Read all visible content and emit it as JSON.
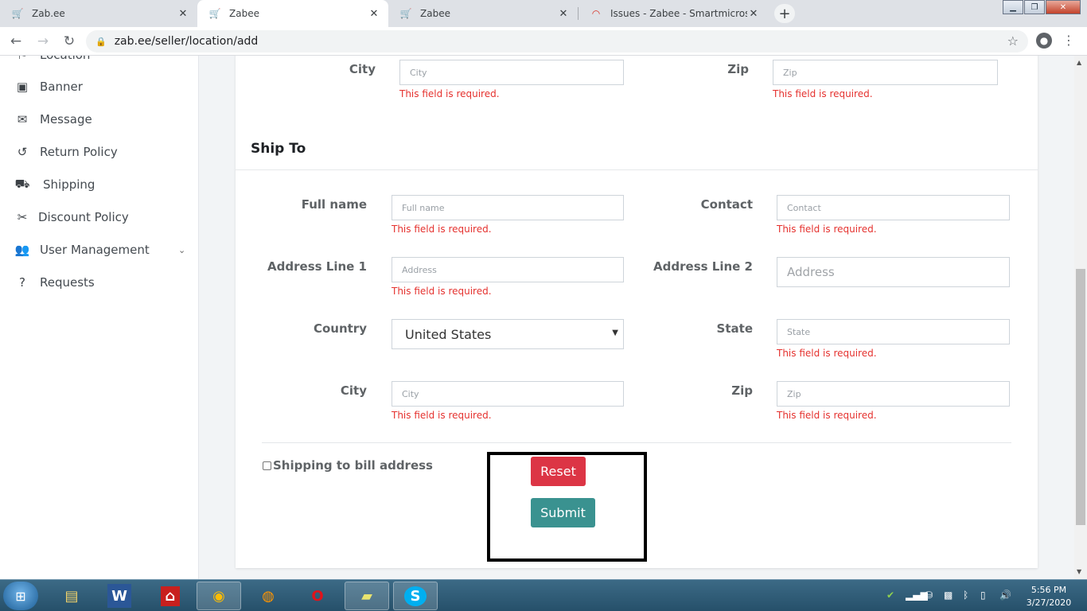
{
  "browser": {
    "tabs": [
      {
        "title": "Zab.ee",
        "active": false
      },
      {
        "title": "Zabee",
        "active": true
      },
      {
        "title": "Zabee",
        "active": false
      },
      {
        "title": "Issues - Zabee - Smartmicros Pro",
        "active": false
      }
    ],
    "url": "zab.ee/seller/location/add"
  },
  "sidebar": {
    "partial_item": "Location",
    "items": [
      {
        "label": "Banner",
        "icon": "image-icon"
      },
      {
        "label": "Message",
        "icon": "envelope-icon"
      },
      {
        "label": "Return Policy",
        "icon": "undo-icon"
      },
      {
        "label": "Shipping",
        "icon": "truck-icon"
      },
      {
        "label": "Discount Policy",
        "icon": "scissors-icon"
      },
      {
        "label": "User Management",
        "icon": "users-icon"
      },
      {
        "label": "Requests",
        "icon": "question-circle-icon"
      }
    ]
  },
  "bill_to_partial": {
    "city_label": "City",
    "city_placeholder": "City",
    "zip_label": "Zip",
    "zip_placeholder": "Zip",
    "error": "This field is required."
  },
  "ship_to": {
    "title": "Ship To",
    "full_name_label": "Full name",
    "full_name_placeholder": "Full name",
    "contact_label": "Contact",
    "contact_placeholder": "Contact",
    "address1_label": "Address Line 1",
    "address1_placeholder": "Address",
    "address2_label": "Address Line 2",
    "address2_placeholder": "Address",
    "country_label": "Country",
    "country_value": "United States",
    "state_label": "State",
    "state_placeholder": "State",
    "city_label": "City",
    "city_placeholder": "City",
    "zip_label": "Zip",
    "zip_placeholder": "Zip",
    "error": "This field is required."
  },
  "form_footer": {
    "checkbox_label": "Shipping to bill address",
    "reset_label": "Reset",
    "submit_label": "Submit"
  },
  "taskbar": {
    "time": "5:56 PM",
    "date": "3/27/2020"
  },
  "colors": {
    "error": "#e5322f",
    "reset": "#dc3545",
    "submit": "#3a9290"
  }
}
